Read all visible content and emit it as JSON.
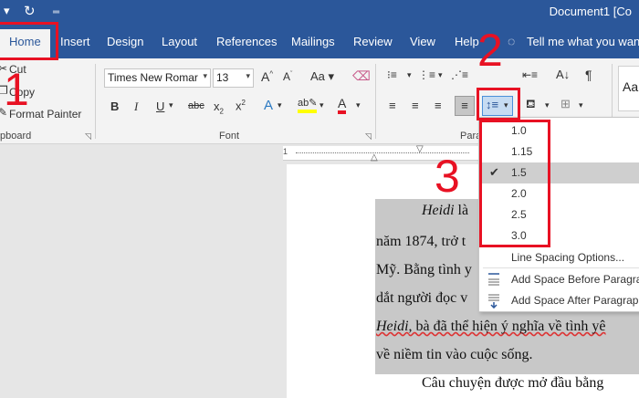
{
  "quick_access": {
    "save_icon": "save-icon",
    "undo_icon": "undo-icon",
    "redo_icon": "redo-icon",
    "customize": "customize-arrow-icon"
  },
  "title": "Document1 [Co",
  "tabs": [
    "Home",
    "Insert",
    "Design",
    "Layout",
    "References",
    "Mailings",
    "Review",
    "View",
    "Help"
  ],
  "tell_me": "Tell me what you want",
  "clipboard": {
    "cut": "Cut",
    "copy": "Copy",
    "format_painter": "Format Painter",
    "group": "pboard"
  },
  "font": {
    "name": "Times New Romar",
    "size": "13",
    "group": "Font"
  },
  "paragraph": {
    "group": "Para"
  },
  "styles": {
    "preview": "Aa"
  },
  "annotations": {
    "one": "1",
    "two": "2",
    "three": "3"
  },
  "line_spacing": {
    "options": [
      "1.0",
      "1.15",
      "1.5",
      "2.0",
      "2.5",
      "3.0"
    ],
    "selected": "1.5",
    "more": "Line Spacing Options...",
    "before": "Add Space Before Paragra",
    "after": "Add Space After Paragrap"
  },
  "document": {
    "line1_a": "Heidi",
    "line1_b": " là",
    "line2": "năm 1874, trở t",
    "line3": "Mỹ. Bằng tình y",
    "line4": "dắt người đọc v",
    "line5_a": "Heidi",
    "line5_b": ", bà đã thể hiện ý nghĩa về tình yê",
    "line6": "về niềm tin vào cuộc sống.",
    "line7": "Câu chuyện được mở đầu bằng"
  },
  "colors": {
    "ribbon_blue": "#2b579a",
    "annotation_red": "#e81123",
    "highlight_gray": "#c8c8c8"
  }
}
